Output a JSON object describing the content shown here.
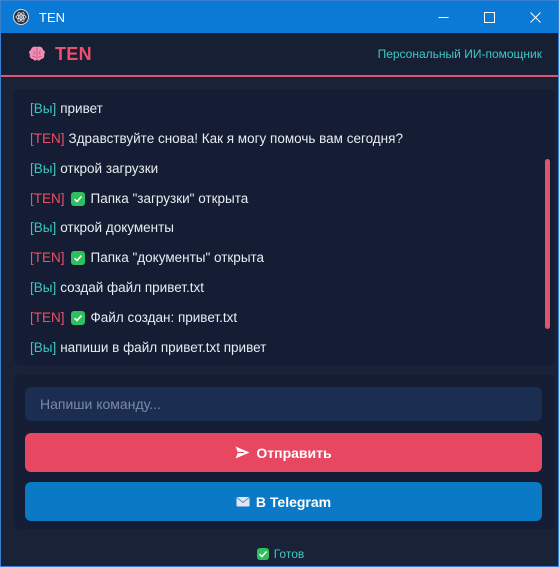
{
  "window": {
    "title": "TEN"
  },
  "header": {
    "brand": "TEN",
    "subtitle": "Персональный ИИ-помощник"
  },
  "chat": {
    "messages": [
      {
        "sender": "[Вы]",
        "text": "привет",
        "check": false
      },
      {
        "sender": "[TEN]",
        "text": "Здравствуйте снова! Как я могу помочь вам сегодня?",
        "check": false
      },
      {
        "sender": "[Вы]",
        "text": "открой загрузки",
        "check": false
      },
      {
        "sender": "[TEN]",
        "text": "Папка \"загрузки\" открыта",
        "check": true
      },
      {
        "sender": "[Вы]",
        "text": "открой документы",
        "check": false
      },
      {
        "sender": "[TEN]",
        "text": "Папка \"документы\" открыта",
        "check": true
      },
      {
        "sender": "[Вы]",
        "text": "создай файл привет.txt",
        "check": false
      },
      {
        "sender": "[TEN]",
        "text": "Файл создан: привет.txt",
        "check": true
      },
      {
        "sender": "[Вы]",
        "text": "напиши в файл привет.txt привет",
        "check": false
      }
    ]
  },
  "input": {
    "placeholder": "Напиши команду...",
    "value": ""
  },
  "buttons": {
    "send_label": "Отправить",
    "telegram_label": "В Telegram"
  },
  "status": {
    "text": "Готов"
  },
  "icons": {
    "app": "electron-icon",
    "brand": "brain-icon",
    "send": "send-arrow-icon",
    "telegram": "envelope-icon",
    "check": "check-icon"
  },
  "colors": {
    "titlebar": "#0b7ad6",
    "background": "#1a2238",
    "accent_red": "#e84762",
    "accent_teal": "#3dc9c6",
    "telegram_blue": "#0b7ac6",
    "check_green": "#2ebf5e"
  }
}
